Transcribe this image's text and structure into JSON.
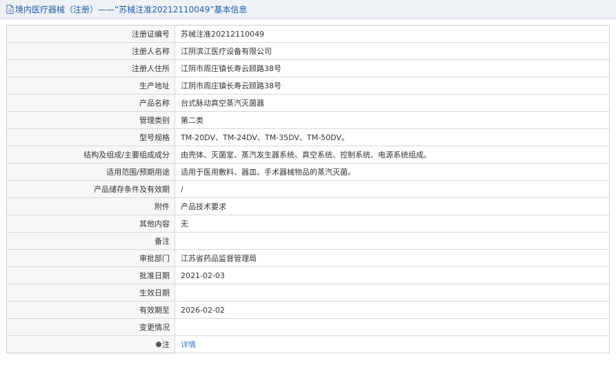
{
  "header": {
    "title": "境内医疗器械（注册）——“苏械注准20212110049”基本信息",
    "icon": "document-icon"
  },
  "rows": [
    {
      "label": "注册证编号",
      "value": "苏械注准20212110049"
    },
    {
      "label": "注册人名称",
      "value": "江阴滨江医疗设备有限公司"
    },
    {
      "label": "注册人住所",
      "value": "江阴市周庄镇长寿云顾路38号"
    },
    {
      "label": "生产地址",
      "value": "江阴市周庄镇长寿云顾路38号"
    },
    {
      "label": "产品名称",
      "value": "台式脉动真空蒸汽灭菌器"
    },
    {
      "label": "管理类别",
      "value": "第二类"
    },
    {
      "label": "型号规格",
      "value": "TM-20DV、TM-24DV、TM-35DV、TM-50DV。"
    },
    {
      "label": "结构及组成/主要组成成分",
      "value": "由壳体、灭菌室、蒸汽发生器系统、真空系统、控制系统、电源系统组成。"
    },
    {
      "label": "适用范围/预期用途",
      "value": "适用于医用敷料、器皿、手术器械物品的蒸汽灭菌。"
    },
    {
      "label": "产品储存条件及有效期",
      "value": "/"
    },
    {
      "label": "附件",
      "value": "产品技术要求"
    },
    {
      "label": "其他内容",
      "value": "无"
    },
    {
      "label": "备注",
      "value": ""
    },
    {
      "label": "审批部门",
      "value": "江苏省药品监督管理局"
    },
    {
      "label": "批准日期",
      "value": "2021-02-03"
    },
    {
      "label": "生效日期",
      "value": ""
    },
    {
      "label": "有效期至",
      "value": "2026-02-02"
    },
    {
      "label": "变更情况",
      "value": ""
    }
  ],
  "note_row": {
    "label": "注",
    "value": "详情",
    "icon": "note-icon"
  },
  "colors": {
    "header_bg": "#eef1f5",
    "header_text": "#1f5fa8",
    "link": "#3a7dc9",
    "label_bg": "#f7f7f7"
  }
}
